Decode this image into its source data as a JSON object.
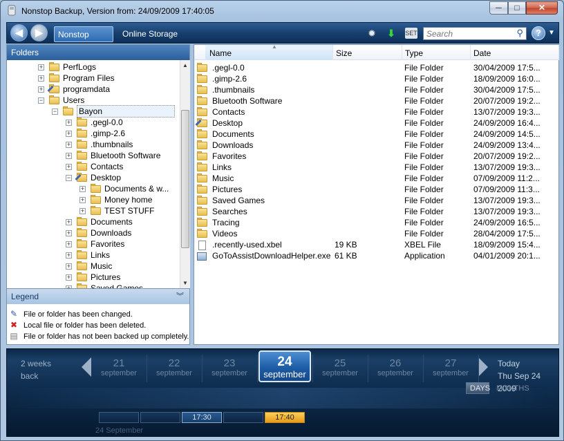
{
  "window": {
    "title": "Nonstop Backup, Version from: 24/09/2009 17:40:05",
    "min": "─",
    "max": "□",
    "close": "✕"
  },
  "toolbar": {
    "back": "◀",
    "forward": "▶",
    "tabs": [
      "Nonstop Backup",
      "Online Storage"
    ],
    "search_placeholder": "Search",
    "icons": [
      "gear-icon",
      "download-icon",
      "setup-icon",
      "search-icon",
      "help-icon"
    ],
    "setup_label": "SET",
    "help": "?",
    "help_arrow": "▼"
  },
  "folders": {
    "title": "Folders",
    "tree": [
      {
        "label": "PerfLogs",
        "exp": "+"
      },
      {
        "label": "Program Files",
        "exp": "+"
      },
      {
        "label": "programdata",
        "exp": "+"
      },
      {
        "label": "Users",
        "exp": "−"
      },
      {
        "label": "Bayon",
        "exp": "−"
      },
      {
        "label": ".gegl-0.0",
        "exp": "+"
      },
      {
        "label": ".gimp-2.6",
        "exp": "+"
      },
      {
        "label": ".thumbnails",
        "exp": "+"
      },
      {
        "label": "Bluetooth Software",
        "exp": "+"
      },
      {
        "label": "Contacts",
        "exp": "+"
      },
      {
        "label": "Desktop",
        "exp": "−"
      },
      {
        "label": "Documents & w...",
        "exp": "+"
      },
      {
        "label": "Money home",
        "exp": "+"
      },
      {
        "label": "TEST STUFF",
        "exp": "+"
      },
      {
        "label": "Documents",
        "exp": "+"
      },
      {
        "label": "Downloads",
        "exp": "+"
      },
      {
        "label": "Favorites",
        "exp": "+"
      },
      {
        "label": "Links",
        "exp": "+"
      },
      {
        "label": "Music",
        "exp": "+"
      },
      {
        "label": "Pictures",
        "exp": "+"
      },
      {
        "label": "Saved Games",
        "exp": "+"
      }
    ]
  },
  "legend": {
    "title": "Legend",
    "chevron": "︾",
    "items": [
      {
        "icon": "✎",
        "text": "File or folder has been changed."
      },
      {
        "icon": "✖",
        "text": "Local file or folder has been deleted."
      },
      {
        "icon": "▤",
        "text": "File or folder has not been backed up completely."
      }
    ]
  },
  "files": {
    "columns": [
      "Name",
      "Size",
      "Type",
      "Date"
    ],
    "rows": [
      {
        "name": ".gegl-0.0",
        "size": "",
        "type": "File Folder",
        "date": "30/04/2009 17:5..."
      },
      {
        "name": ".gimp-2.6",
        "size": "",
        "type": "File Folder",
        "date": "18/09/2009 16:0..."
      },
      {
        "name": ".thumbnails",
        "size": "",
        "type": "File Folder",
        "date": "30/04/2009 17:5..."
      },
      {
        "name": "Bluetooth Software",
        "size": "",
        "type": "File Folder",
        "date": "20/07/2009 19:2..."
      },
      {
        "name": "Contacts",
        "size": "",
        "type": "File Folder",
        "date": "13/07/2009 19:3..."
      },
      {
        "name": "Desktop",
        "size": "",
        "type": "File Folder",
        "date": "24/09/2009 16:4..."
      },
      {
        "name": "Documents",
        "size": "",
        "type": "File Folder",
        "date": "24/09/2009 14:5..."
      },
      {
        "name": "Downloads",
        "size": "",
        "type": "File Folder",
        "date": "24/09/2009 13:4..."
      },
      {
        "name": "Favorites",
        "size": "",
        "type": "File Folder",
        "date": "20/07/2009 19:2..."
      },
      {
        "name": "Links",
        "size": "",
        "type": "File Folder",
        "date": "13/07/2009 19:3..."
      },
      {
        "name": "Music",
        "size": "",
        "type": "File Folder",
        "date": "07/09/2009 11:2..."
      },
      {
        "name": "Pictures",
        "size": "",
        "type": "File Folder",
        "date": "07/09/2009 11:3..."
      },
      {
        "name": "Saved Games",
        "size": "",
        "type": "File Folder",
        "date": "13/07/2009 19:3..."
      },
      {
        "name": "Searches",
        "size": "",
        "type": "File Folder",
        "date": "13/07/2009 19:3..."
      },
      {
        "name": "Tracing",
        "size": "",
        "type": "File Folder",
        "date": "24/09/2009 16:5..."
      },
      {
        "name": "Videos",
        "size": "",
        "type": "File Folder",
        "date": "28/04/2009 17:5..."
      },
      {
        "name": ".recently-used.xbel",
        "size": "19 KB",
        "type": "XBEL File",
        "date": "18/09/2009 15:4..."
      },
      {
        "name": "GoToAssistDownloadHelper.exe",
        "size": "61 KB",
        "type": "Application",
        "date": "04/01/2009 20:1..."
      }
    ]
  },
  "timeline": {
    "back_line1": "2 weeks",
    "back_line2": "back",
    "days": [
      {
        "num": "21",
        "mon": "september"
      },
      {
        "num": "22",
        "mon": "september"
      },
      {
        "num": "23",
        "mon": "september"
      },
      {
        "num": "25",
        "mon": "september"
      },
      {
        "num": "26",
        "mon": "september"
      },
      {
        "num": "27",
        "mon": "september"
      }
    ],
    "selected": {
      "num": "24",
      "mon": "september"
    },
    "today": "Today",
    "today_date": "Thu Sep 24 2009",
    "view_days": "DAYS",
    "view_months": "MONTHS",
    "slots": [
      "",
      "",
      "17:30",
      "",
      "17:40"
    ],
    "date_label": "24 September"
  }
}
